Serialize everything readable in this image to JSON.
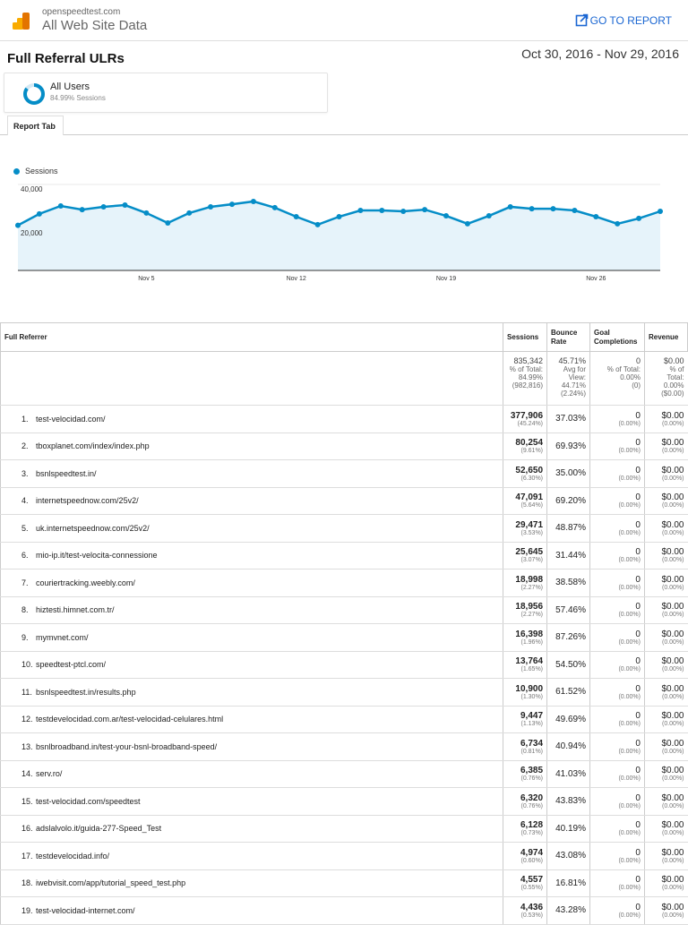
{
  "header": {
    "site": "openspeedtest.com",
    "view": "All Web Site Data",
    "go_to_report": "GO TO REPORT"
  },
  "report": {
    "title": "Full Referral ULRs",
    "date_range": "Oct 30, 2016 - Nov 29, 2016"
  },
  "segment": {
    "name": "All Users",
    "detail": "84.99% Sessions",
    "fraction": 0.8499
  },
  "tabs": [
    {
      "label": "Report Tab"
    }
  ],
  "colors": {
    "accent": "#058dc7",
    "fill": "#e6f3fa",
    "link": "#1a66d2"
  },
  "chart_data": {
    "type": "area",
    "legend": [
      "Sessions"
    ],
    "legend_position": "top-left",
    "yticks": [
      "40,000",
      "20,000"
    ],
    "ytick_values": [
      40000,
      20000
    ],
    "ylim": [
      0,
      40000
    ],
    "xticks": [
      {
        "label": "Nov 5",
        "index": 6
      },
      {
        "label": "Nov 12",
        "index": 13
      },
      {
        "label": "Nov 19",
        "index": 20
      },
      {
        "label": "Nov 26",
        "index": 27
      }
    ],
    "x_start": "Oct 30",
    "x_end": "Nov 29",
    "series": [
      {
        "name": "Sessions",
        "values": [
          21000,
          26300,
          30000,
          28300,
          29600,
          30400,
          26700,
          22100,
          26700,
          29600,
          30800,
          32100,
          29200,
          25000,
          21300,
          25000,
          27900,
          27900,
          27500,
          28300,
          25400,
          21700,
          25400,
          29600,
          28700,
          28700,
          27900,
          25000,
          21700,
          24200,
          27500
        ]
      }
    ]
  },
  "table": {
    "headers": [
      "Full Referrer",
      "Sessions",
      "Bounce Rate",
      "Goal Completions",
      "Revenue"
    ],
    "totals": {
      "sessions": [
        "835,342",
        "% of Total:",
        "84.99%",
        "(982,816)"
      ],
      "bounce": [
        "45.71%",
        "Avg for",
        "View:",
        "44.71%",
        "(2.24%)"
      ],
      "goals": [
        "0",
        "% of Total:",
        "0.00%",
        "(0)"
      ],
      "revenue": [
        "$0.00",
        "% of",
        "Total:",
        "0.00%",
        "($0.00)"
      ]
    },
    "rows": [
      {
        "n": "1.",
        "ref": "test-velocidad.com/",
        "s": "377,906",
        "sp": "(45.24%)",
        "b": "37.03%",
        "g": "0",
        "gp": "(0.00%)",
        "r": "$0.00",
        "rp": "(0.00%)"
      },
      {
        "n": "2.",
        "ref": "tboxplanet.com/index/index.php",
        "s": "80,254",
        "sp": "(9.61%)",
        "b": "69.93%",
        "g": "0",
        "gp": "(0.00%)",
        "r": "$0.00",
        "rp": "(0.00%)"
      },
      {
        "n": "3.",
        "ref": "bsnlspeedtest.in/",
        "s": "52,650",
        "sp": "(6.30%)",
        "b": "35.00%",
        "g": "0",
        "gp": "(0.00%)",
        "r": "$0.00",
        "rp": "(0.00%)"
      },
      {
        "n": "4.",
        "ref": "internetspeednow.com/25v2/",
        "s": "47,091",
        "sp": "(5.64%)",
        "b": "69.20%",
        "g": "0",
        "gp": "(0.00%)",
        "r": "$0.00",
        "rp": "(0.00%)"
      },
      {
        "n": "5.",
        "ref": "uk.internetspeednow.com/25v2/",
        "s": "29,471",
        "sp": "(3.53%)",
        "b": "48.87%",
        "g": "0",
        "gp": "(0.00%)",
        "r": "$0.00",
        "rp": "(0.00%)"
      },
      {
        "n": "6.",
        "ref": "mio-ip.it/test-velocita-connessione",
        "s": "25,645",
        "sp": "(3.07%)",
        "b": "31.44%",
        "g": "0",
        "gp": "(0.00%)",
        "r": "$0.00",
        "rp": "(0.00%)"
      },
      {
        "n": "7.",
        "ref": "couriertracking.weebly.com/",
        "s": "18,998",
        "sp": "(2.27%)",
        "b": "38.58%",
        "g": "0",
        "gp": "(0.00%)",
        "r": "$0.00",
        "rp": "(0.00%)"
      },
      {
        "n": "8.",
        "ref": "hiztesti.himnet.com.tr/",
        "s": "18,956",
        "sp": "(2.27%)",
        "b": "57.46%",
        "g": "0",
        "gp": "(0.00%)",
        "r": "$0.00",
        "rp": "(0.00%)"
      },
      {
        "n": "9.",
        "ref": "mymvnet.com/",
        "s": "16,398",
        "sp": "(1.96%)",
        "b": "87.26%",
        "g": "0",
        "gp": "(0.00%)",
        "r": "$0.00",
        "rp": "(0.00%)"
      },
      {
        "n": "10.",
        "ref": "speedtest-ptcl.com/",
        "s": "13,764",
        "sp": "(1.65%)",
        "b": "54.50%",
        "g": "0",
        "gp": "(0.00%)",
        "r": "$0.00",
        "rp": "(0.00%)"
      },
      {
        "n": "11.",
        "ref": "bsnlspeedtest.in/results.php",
        "s": "10,900",
        "sp": "(1.30%)",
        "b": "61.52%",
        "g": "0",
        "gp": "(0.00%)",
        "r": "$0.00",
        "rp": "(0.00%)"
      },
      {
        "n": "12.",
        "ref": "testdevelocidad.com.ar/test-velocidad-celulares.html",
        "s": "9,447",
        "sp": "(1.13%)",
        "b": "49.69%",
        "g": "0",
        "gp": "(0.00%)",
        "r": "$0.00",
        "rp": "(0.00%)"
      },
      {
        "n": "13.",
        "ref": "bsnlbroadband.in/test-your-bsnl-broadband-speed/",
        "s": "6,734",
        "sp": "(0.81%)",
        "b": "40.94%",
        "g": "0",
        "gp": "(0.00%)",
        "r": "$0.00",
        "rp": "(0.00%)"
      },
      {
        "n": "14.",
        "ref": "serv.ro/",
        "s": "6,385",
        "sp": "(0.76%)",
        "b": "41.03%",
        "g": "0",
        "gp": "(0.00%)",
        "r": "$0.00",
        "rp": "(0.00%)"
      },
      {
        "n": "15.",
        "ref": "test-velocidad.com/speedtest",
        "s": "6,320",
        "sp": "(0.76%)",
        "b": "43.83%",
        "g": "0",
        "gp": "(0.00%)",
        "r": "$0.00",
        "rp": "(0.00%)"
      },
      {
        "n": "16.",
        "ref": "adslalvolo.it/guida-277-Speed_Test",
        "s": "6,128",
        "sp": "(0.73%)",
        "b": "40.19%",
        "g": "0",
        "gp": "(0.00%)",
        "r": "$0.00",
        "rp": "(0.00%)"
      },
      {
        "n": "17.",
        "ref": "testdevelocidad.info/",
        "s": "4,974",
        "sp": "(0.60%)",
        "b": "43.08%",
        "g": "0",
        "gp": "(0.00%)",
        "r": "$0.00",
        "rp": "(0.00%)"
      },
      {
        "n": "18.",
        "ref": "iwebvisit.com/app/tutorial_speed_test.php",
        "s": "4,557",
        "sp": "(0.55%)",
        "b": "16.81%",
        "g": "0",
        "gp": "(0.00%)",
        "r": "$0.00",
        "rp": "(0.00%)"
      },
      {
        "n": "19.",
        "ref": "test-velocidad-internet.com/",
        "s": "4,436",
        "sp": "(0.53%)",
        "b": "43.28%",
        "g": "0",
        "gp": "(0.00%)",
        "r": "$0.00",
        "rp": "(0.00%)"
      }
    ]
  }
}
